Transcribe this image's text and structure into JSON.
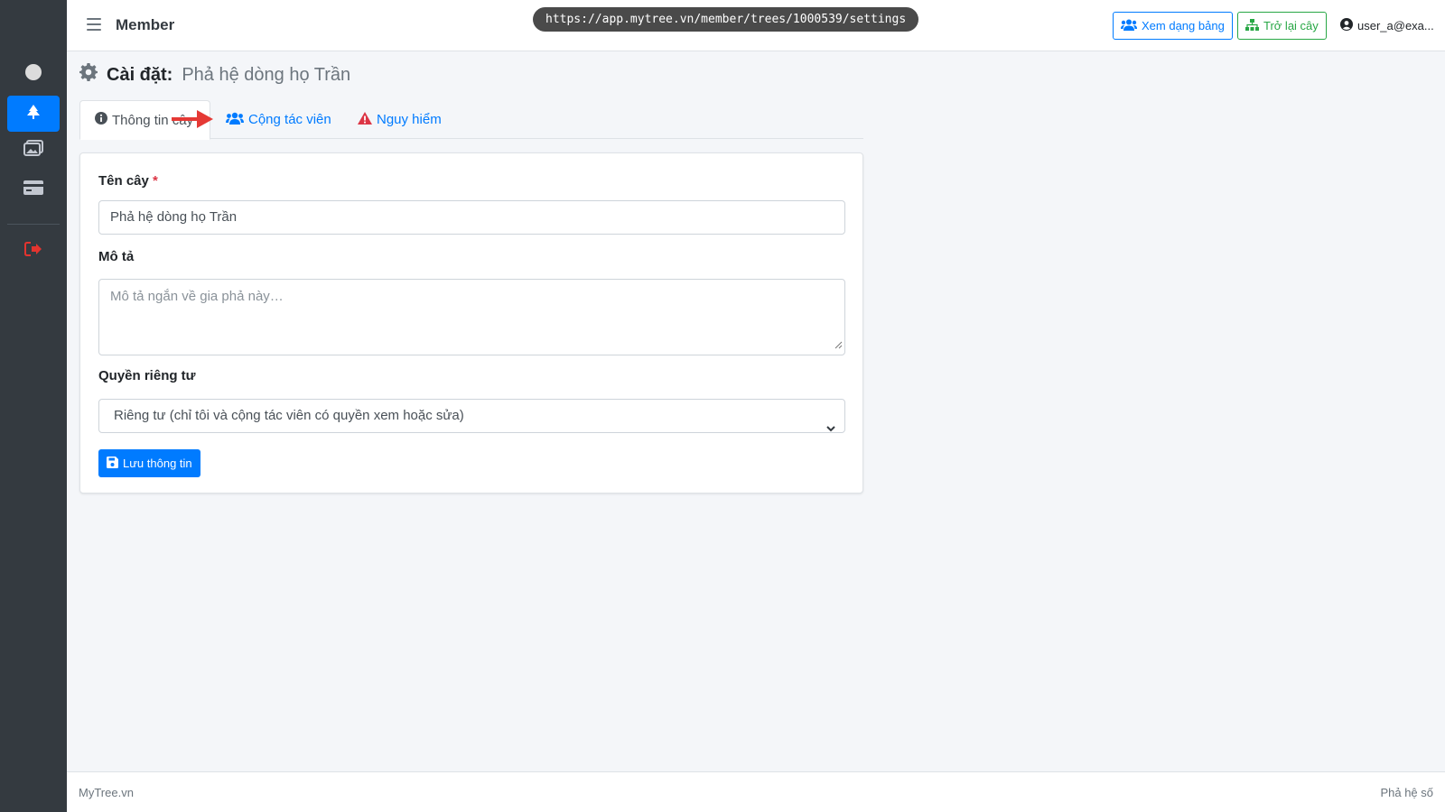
{
  "browser": {
    "url": "https://app.mytree.vn/member/trees/1000539/settings"
  },
  "header": {
    "brand": "Member",
    "view_table_label": "Xem dạng bảng",
    "back_to_tree_label": "Trở lại cây",
    "user_label": "user_a@exa..."
  },
  "sidebar": {
    "items": [
      {
        "icon": "circle-icon"
      },
      {
        "icon": "tree-icon",
        "active": true
      },
      {
        "icon": "images-icon"
      },
      {
        "icon": "credit-card-icon"
      },
      {
        "icon": "sign-out-icon"
      }
    ]
  },
  "page": {
    "title_label": "Cài đặt:",
    "title_name": "Phả hệ dòng họ Trần"
  },
  "tabs": [
    {
      "label": "Thông tin cây",
      "icon": "info-icon",
      "active": true
    },
    {
      "label": "Cộng tác viên",
      "icon": "users-icon"
    },
    {
      "label": "Nguy hiểm",
      "icon": "warning-icon"
    }
  ],
  "form": {
    "name_label": "Tên cây",
    "name_required": "*",
    "name_value": "Phả hệ dòng họ Trần",
    "description_label": "Mô tả",
    "description_placeholder": "Mô tả ngắn về gia phả này…",
    "privacy_label": "Quyền riêng tư",
    "privacy_value": "Riêng tư (chỉ tôi và cộng tác viên có quyền xem hoặc sửa)",
    "save_label": "Lưu thông tin"
  },
  "footer": {
    "left": "MyTree.vn",
    "right": "Phả hệ số"
  },
  "colors": {
    "primary": "#007bff",
    "success": "#28a745",
    "danger": "#dc3545",
    "sidebar_bg": "#343a40"
  }
}
